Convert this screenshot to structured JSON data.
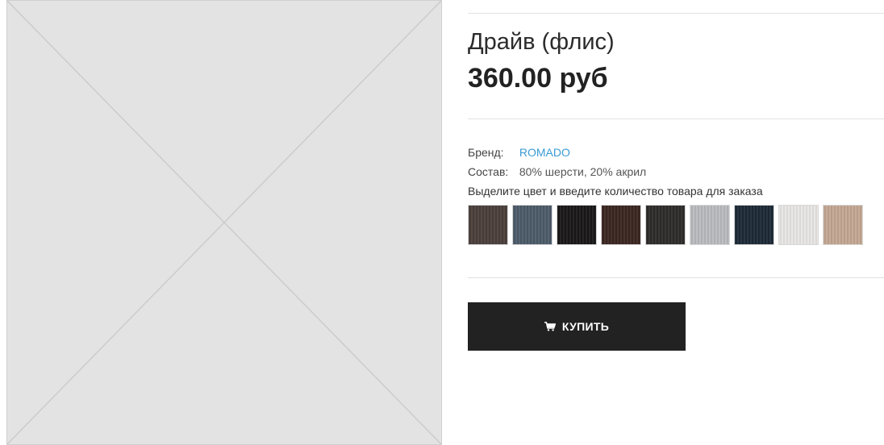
{
  "product": {
    "title": "Драйв (флис)",
    "price": "360.00 руб"
  },
  "specs": [
    {
      "label": "Бренд:",
      "value": "ROMADO"
    },
    {
      "label": "Состав:",
      "value": "80% шерсти, 20% акрил"
    }
  ],
  "color_prompt": "Выделите цвет и введите количество товара для заказа",
  "swatches": [
    {
      "color": "#4a3f3a"
    },
    {
      "color": "#4d5a69"
    },
    {
      "color": "#1a1717"
    },
    {
      "color": "#3a2621"
    },
    {
      "color": "#2e2c2b"
    },
    {
      "color": "#b9bbbe"
    },
    {
      "color": "#1d2a36"
    },
    {
      "color": "#e9e7e4"
    },
    {
      "color": "#c4a893"
    }
  ],
  "buy_button": {
    "label": "КУПИТЬ",
    "icon": "cart-icon"
  }
}
